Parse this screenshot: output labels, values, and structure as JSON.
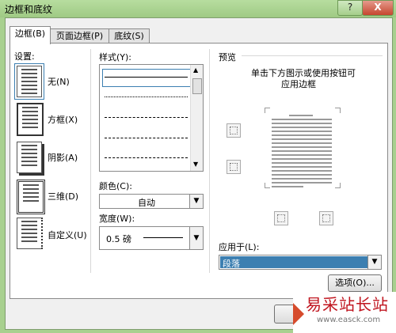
{
  "window": {
    "title": "边框和底纹",
    "help_btn": "?",
    "close_btn": "X"
  },
  "tabs": [
    {
      "label": "边框(B)",
      "active": true
    },
    {
      "label": "页面边框(P)",
      "active": false
    },
    {
      "label": "底纹(S)",
      "active": false
    }
  ],
  "settings": {
    "heading": "设置:",
    "items": [
      {
        "label": "无(N)",
        "icon": "none-border-icon"
      },
      {
        "label": "方框(X)",
        "icon": "box-border-icon"
      },
      {
        "label": "阴影(A)",
        "icon": "shadow-border-icon"
      },
      {
        "label": "三维(D)",
        "icon": "3d-border-icon"
      },
      {
        "label": "自定义(U)",
        "icon": "custom-border-icon"
      }
    ],
    "selected": "无(N)"
  },
  "style": {
    "label": "样式(Y):"
  },
  "color": {
    "label": "颜色(C):",
    "value": "自动"
  },
  "width": {
    "label": "宽度(W):",
    "value": "0.5 磅"
  },
  "preview": {
    "heading": "预览",
    "hint_line1": "单击下方图示或使用按钮可",
    "hint_line2": "应用边框"
  },
  "apply": {
    "label": "应用于(L):",
    "value": "段落"
  },
  "buttons": {
    "options": "选项(O)..."
  },
  "watermark": {
    "text": "易采站长站",
    "url": "www.easck.com"
  },
  "colors": {
    "window_frame": "#a8d08f",
    "selection": "#3c7fb1",
    "watermark_red": "#c0141e"
  }
}
